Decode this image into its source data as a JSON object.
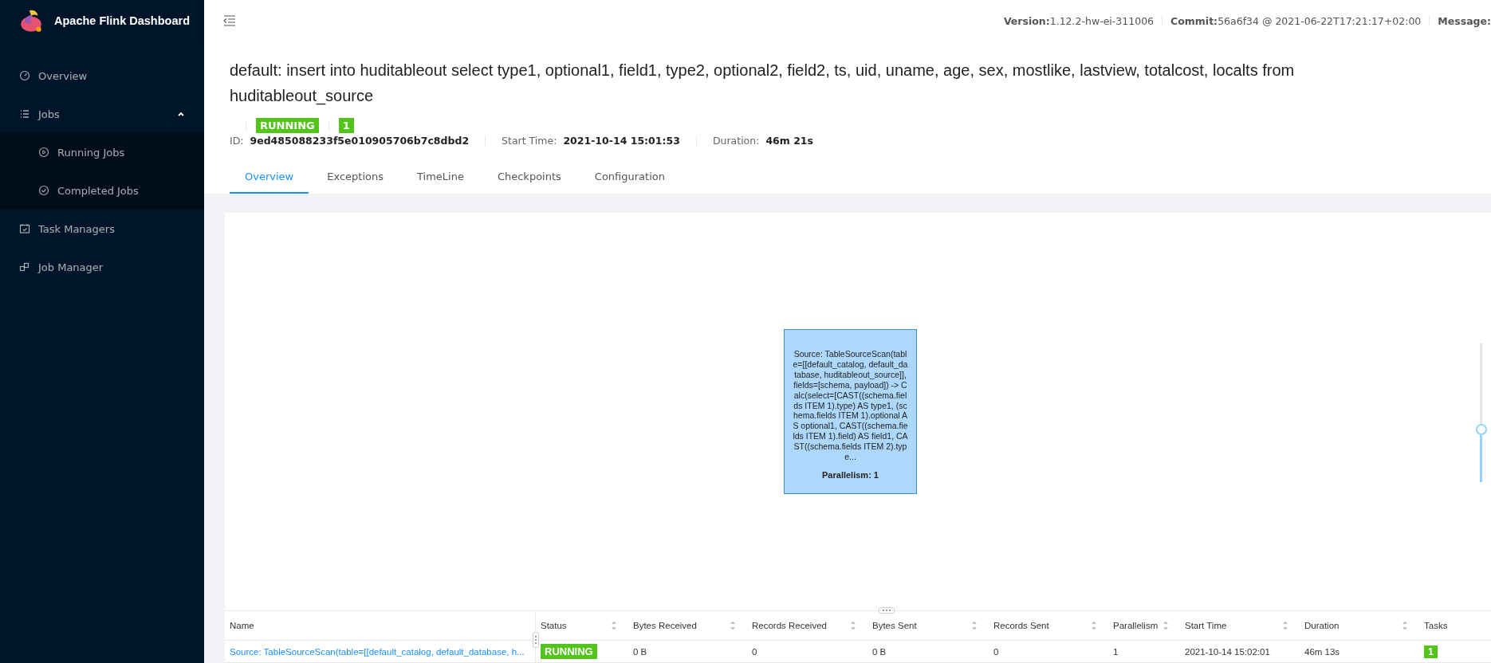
{
  "sidebar": {
    "brand": "Apache Flink Dashboard",
    "items": [
      {
        "kind": "overview",
        "label": "Overview"
      },
      {
        "kind": "jobs",
        "label": "Jobs",
        "expanded": true,
        "children": [
          {
            "kind": "running",
            "label": "Running Jobs"
          },
          {
            "kind": "completed",
            "label": "Completed Jobs"
          }
        ]
      },
      {
        "kind": "taskmanagers",
        "label": "Task Managers"
      },
      {
        "kind": "jobmanager",
        "label": "Job Manager"
      }
    ]
  },
  "header": {
    "info": [
      {
        "label": "Version:",
        "value": "1.12.2-hw-ei-311006"
      },
      {
        "label": "Commit:",
        "value": "56a6f34 @ 2021-06-22T17:21:17+02:00"
      },
      {
        "label": "Message:"
      }
    ]
  },
  "job": {
    "title": "default: insert into huditableout select type1, optional1, field1, type2, optional2, field2, ts, uid, uname, age, sex, mostlike, lastview, totalcost, localts from huditableout_source",
    "status": "RUNNING",
    "task_count": "1",
    "meta": [
      {
        "label": "ID:",
        "value": "9ed485088233f5e010905706b7c8dbd2"
      },
      {
        "label": "Start Time:",
        "value": "2021-10-14 15:01:53"
      },
      {
        "label": "Duration:",
        "value": "46m 21s"
      }
    ]
  },
  "tabs": [
    {
      "label": "Overview",
      "selected": true
    },
    {
      "label": "Exceptions",
      "selected": false
    },
    {
      "label": "TimeLine",
      "selected": false
    },
    {
      "label": "Checkpoints",
      "selected": false
    },
    {
      "label": "Configuration",
      "selected": false
    }
  ],
  "graph": {
    "node": {
      "description": "Source: TableSourceScan(table=[[default_catalog, default_database, huditableout_source]], fields=[schema, payload]) -> Calc(select=[CAST((schema.fields ITEM 1).type) AS type1, (schema.fields ITEM 1).optional AS optional1, CAST((schema.fields ITEM 1).field) AS field1, CAST((schema.fields ITEM 2).type...",
      "parallelism": "Parallelism: 1"
    },
    "zoom": {
      "level": 0.35
    }
  },
  "table": {
    "columns": [
      {
        "label": "Name",
        "sortable": false
      },
      {
        "label": "Status",
        "sortable": true
      },
      {
        "label": "Bytes Received",
        "sortable": true
      },
      {
        "label": "Records Received",
        "sortable": true
      },
      {
        "label": "Bytes Sent",
        "sortable": true
      },
      {
        "label": "Records Sent",
        "sortable": true
      },
      {
        "label": "Parallelism",
        "sortable": true
      },
      {
        "label": "Start Time",
        "sortable": true
      },
      {
        "label": "Duration",
        "sortable": true
      },
      {
        "label": "Tasks",
        "sortable": false
      }
    ],
    "rows": [
      {
        "name": "Source: TableSourceScan(table=[[default_catalog, default_database, h...",
        "status": "RUNNING",
        "bytes_received": "0 B",
        "records_received": "0",
        "bytes_sent": "0 B",
        "records_sent": "0",
        "parallelism": "1",
        "start_time": "2021-10-14 15:02:01",
        "duration": "46m 13s",
        "tasks": "1"
      }
    ]
  }
}
